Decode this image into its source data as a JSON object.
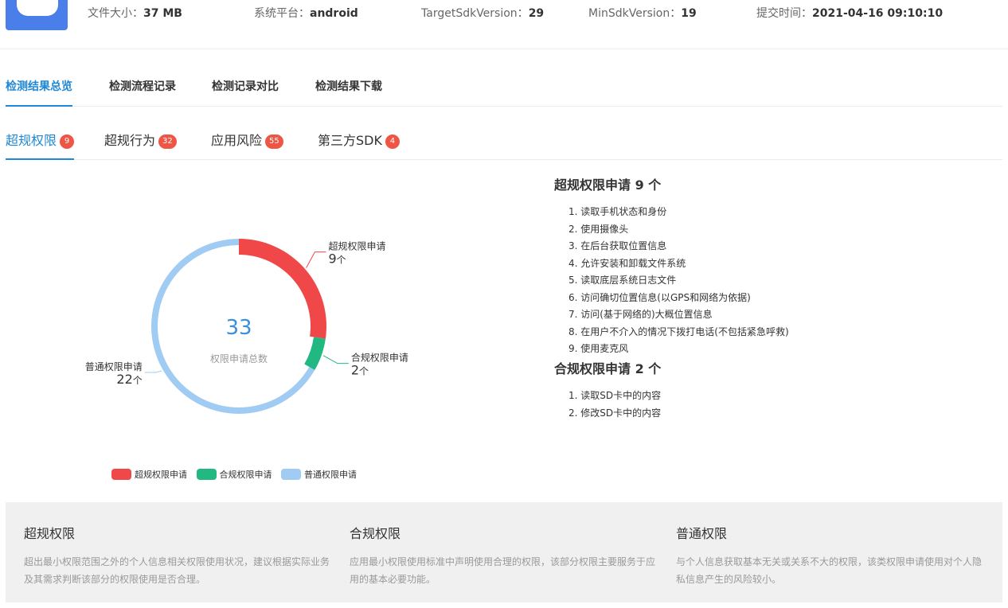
{
  "header": {
    "items": [
      {
        "label": "文件大小：",
        "value": "37 MB"
      },
      {
        "label": "系统平台：",
        "value": "android"
      },
      {
        "label": "TargetSdkVersion：",
        "value": "29"
      },
      {
        "label": "MinSdkVersion：",
        "value": "19"
      },
      {
        "label": "提交时间：",
        "value": "2021-04-16 09:10:10"
      }
    ]
  },
  "main_tabs": [
    {
      "label": "检测结果总览",
      "active": true
    },
    {
      "label": "检测流程记录"
    },
    {
      "label": "检测记录对比"
    },
    {
      "label": "检测结果下载"
    }
  ],
  "sub_tabs": [
    {
      "label": "超规权限",
      "count": "9",
      "active": true
    },
    {
      "label": "超规行为",
      "count": "32"
    },
    {
      "label": "应用风险",
      "count": "55"
    },
    {
      "label": "第三方SDK",
      "count": "4"
    }
  ],
  "chart_data": {
    "type": "pie",
    "categories": [
      "超规权限申请",
      "合规权限申请",
      "普通权限申请"
    ],
    "values": [
      9,
      2,
      22
    ],
    "unit": "个",
    "colors": [
      "#f04848",
      "#22b882",
      "#a0cbf3"
    ],
    "center_value": "33",
    "center_label": "权限申请总数",
    "legend": "bottom-left"
  },
  "lists": [
    {
      "title": "超规权限申请 9 个",
      "items": [
        "1. 读取手机状态和身份",
        "2. 使用摄像头",
        "3. 在后台获取位置信息",
        "4. 允许安装和卸载文件系统",
        "5. 读取底层系统日志文件",
        "6. 访问确切位置信息(以GPS和网络为依据)",
        "7. 访问(基于网络的)大概位置信息",
        "8. 在用户不介入的情况下拨打电话(不包括紧急呼救)",
        "9. 使用麦克风"
      ]
    },
    {
      "title": "合规权限申请 2 个",
      "items": [
        "1. 读取SD卡中的内容",
        "2. 修改SD卡中的内容"
      ]
    }
  ],
  "descriptions": [
    {
      "title": "超规权限",
      "text": "超出最小权限范围之外的个人信息相关权限使用状况，建议根据实际业务及其需求判断该部分的权限使用是否合理。"
    },
    {
      "title": "合规权限",
      "text": "应用最小权限使用标准中声明使用合理的权限，该部分权限主要服务于应用的基本必要功能。"
    },
    {
      "title": "普通权限",
      "text": "与个人信息获取基本无关或关系不大的权限，该类权限申请使用对个人隐私信息产生的风险较小。"
    }
  ]
}
